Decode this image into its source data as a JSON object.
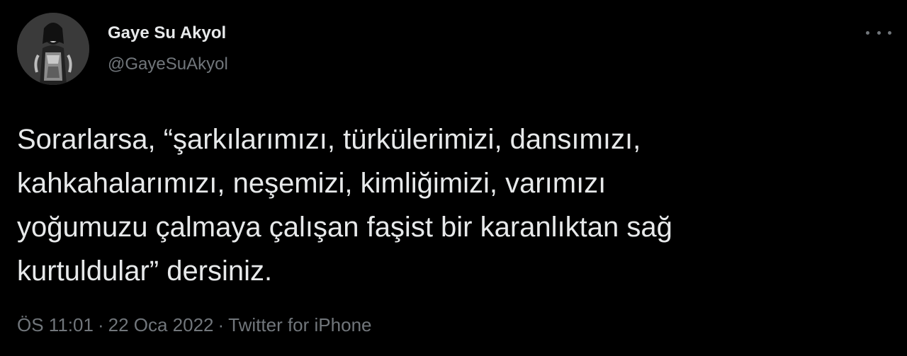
{
  "author": {
    "display_name": "Gaye Su Akyol",
    "handle": "@GayeSuAkyol",
    "avatar_icon": "profile-photo"
  },
  "more_menu": {
    "icon": "more-horizontal-icon"
  },
  "tweet": {
    "lines": [
      "Sorarlarsa, “şarkılarımızı, türkülerimizi, dansımızı,",
      "kahkahalarımızı, neşemizi, kimliğimizi, varımızı",
      "yoğumuzu çalmaya çalışan faşist bir karanlıktan sağ",
      "kurtuldular” dersiniz."
    ]
  },
  "meta": {
    "time": "ÖS 11:01",
    "separator": "·",
    "date": "22 Oca 2022",
    "source": "Twitter for iPhone"
  },
  "colors": {
    "background": "#000000",
    "primary_text": "#e7e9ea",
    "secondary_text": "#71767b"
  }
}
